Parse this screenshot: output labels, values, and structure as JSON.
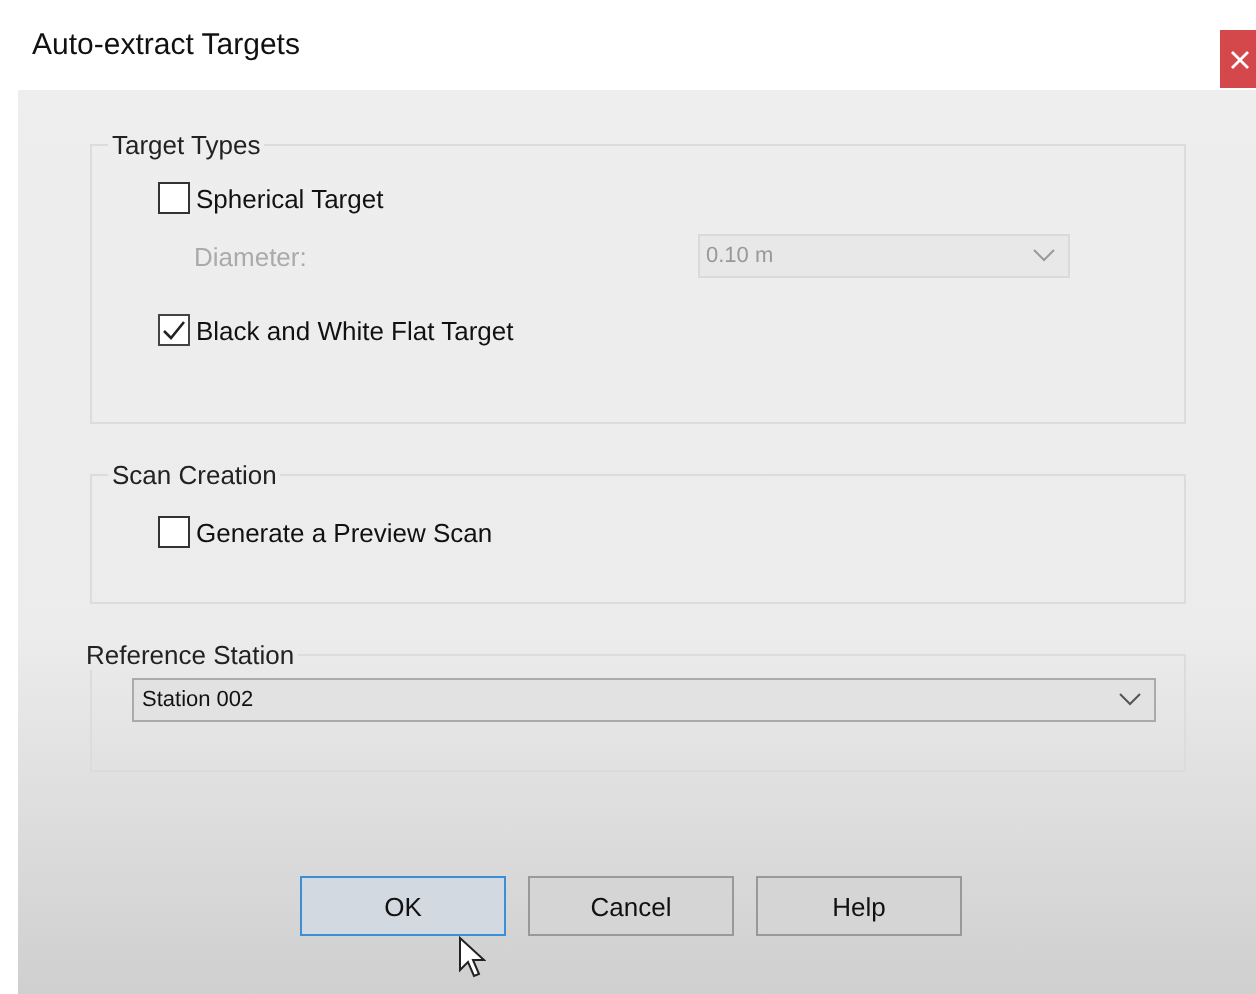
{
  "window": {
    "title": "Auto-extract Targets"
  },
  "groups": [
    {
      "title": "Target Types",
      "rows": [
        {
          "kind": "checkbox",
          "label": "Spherical Target",
          "checked": false
        },
        {
          "kind": "dropdown",
          "label": "Diameter:",
          "value": "0.10 m",
          "disabled": true
        },
        {
          "kind": "checkbox",
          "label": "Black and White Flat Target",
          "checked": true
        }
      ]
    },
    {
      "title": "Scan Creation",
      "rows": [
        {
          "kind": "checkbox",
          "label": "Generate a Preview Scan",
          "checked": false
        }
      ]
    },
    {
      "title": "Reference Station",
      "rows": [
        {
          "kind": "select",
          "value": "Station 002",
          "disabled": false
        }
      ]
    }
  ],
  "buttons": [
    {
      "label": "OK",
      "selected": true
    },
    {
      "label": "Cancel",
      "selected": false
    },
    {
      "label": "Help",
      "selected": false
    }
  ]
}
